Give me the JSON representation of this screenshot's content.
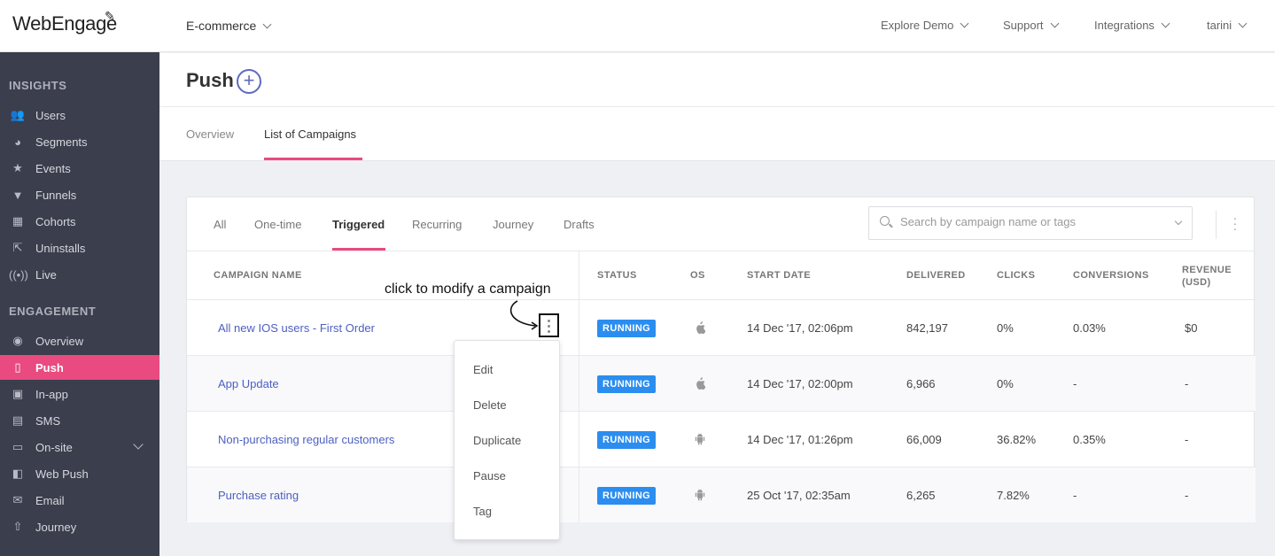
{
  "brand": {
    "logo_text": "WebEngage"
  },
  "header": {
    "project": "E-commerce",
    "nav": [
      "Explore Demo",
      "Support",
      "Integrations",
      "tarini"
    ]
  },
  "sidebar": {
    "sections": [
      {
        "title": "INSIGHTS",
        "items": [
          {
            "label": "Users",
            "icon": "users-icon"
          },
          {
            "label": "Segments",
            "icon": "pie-icon"
          },
          {
            "label": "Events",
            "icon": "star-icon"
          },
          {
            "label": "Funnels",
            "icon": "funnel-icon"
          },
          {
            "label": "Cohorts",
            "icon": "grid-icon"
          },
          {
            "label": "Uninstalls",
            "icon": "uninstall-icon"
          },
          {
            "label": "Live",
            "icon": "live-icon"
          }
        ]
      },
      {
        "title": "ENGAGEMENT",
        "items": [
          {
            "label": "Overview",
            "icon": "eye-icon"
          },
          {
            "label": "Push",
            "icon": "push-icon",
            "active": true
          },
          {
            "label": "In-app",
            "icon": "inapp-icon"
          },
          {
            "label": "SMS",
            "icon": "sms-icon"
          },
          {
            "label": "On-site",
            "icon": "onsite-icon"
          },
          {
            "label": "Web Push",
            "icon": "webpush-icon"
          },
          {
            "label": "Email",
            "icon": "email-icon"
          },
          {
            "label": "Journey",
            "icon": "rocket-icon"
          }
        ]
      }
    ]
  },
  "page": {
    "title": "Push",
    "tabs": [
      "Overview",
      "List of Campaigns"
    ],
    "active_tab": "List of Campaigns"
  },
  "campaigns": {
    "filter_tabs": [
      "All",
      "One-time",
      "Triggered",
      "Recurring",
      "Journey",
      "Drafts"
    ],
    "active_filter": "Triggered",
    "search_placeholder": "Search by campaign name or tags",
    "columns": {
      "name": "CAMPAIGN NAME",
      "status": "STATUS",
      "os": "OS",
      "start": "START DATE",
      "delivered": "DELIVERED",
      "clicks": "CLICKS",
      "conversions": "CONVERSIONS",
      "revenue_line1": "REVENUE",
      "revenue_line2": "(USD)"
    },
    "rows": [
      {
        "name": "All new IOS users - First Order",
        "status": "RUNNING",
        "os": "apple",
        "start": "14 Dec '17, 02:06pm",
        "delivered": "842,197",
        "clicks": "0%",
        "conversions": "0.03%",
        "revenue": "$0"
      },
      {
        "name": "App Update",
        "status": "RUNNING",
        "os": "apple",
        "start": "14 Dec '17, 02:00pm",
        "delivered": "6,966",
        "clicks": "0%",
        "conversions": "-",
        "revenue": "-"
      },
      {
        "name": "Non-purchasing regular customers",
        "status": "RUNNING",
        "os": "android",
        "start": "14 Dec '17, 01:26pm",
        "delivered": "66,009",
        "clicks": "36.82%",
        "conversions": "0.35%",
        "revenue": "-"
      },
      {
        "name": "Purchase rating",
        "status": "RUNNING",
        "os": "android",
        "start": "25 Oct '17, 02:35am",
        "delivered": "6,265",
        "clicks": "7.82%",
        "conversions": "-",
        "revenue": "-"
      }
    ]
  },
  "annotation": "click to modify a campaign",
  "row_menu": [
    "Edit",
    "Delete",
    "Duplicate",
    "Pause",
    "Tag"
  ],
  "colors": {
    "accent": "#e94a7f",
    "link": "#4d5fc0",
    "badge": "#2b8def",
    "sidebar": "#3b3e4c"
  }
}
